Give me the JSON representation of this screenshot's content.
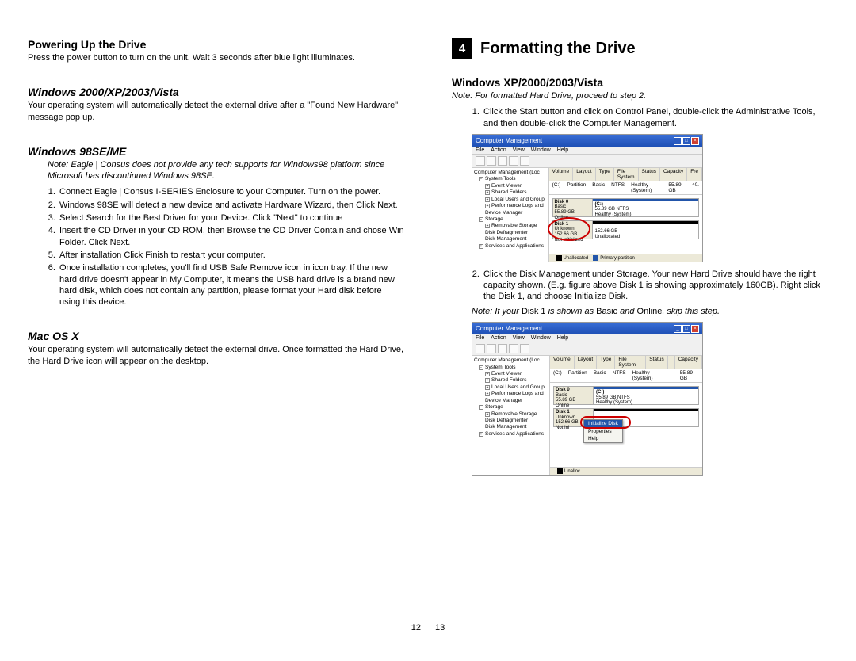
{
  "left": {
    "powering": {
      "heading": "Powering Up the Drive",
      "body": "Press the power button to turn on the unit. Wait 3 seconds after blue light illuminates."
    },
    "win2000": {
      "heading": "Windows 2000/XP/2003/Vista",
      "body": "Your operating system will automatically detect the external drive after a \"Found New Hardware\" message pop up."
    },
    "win98": {
      "heading": "Windows 98SE/ME",
      "note": "Note: Eagle | Consus does not provide any tech supports for Windows98 platform since Microsoft has discontinued Windows 98SE.",
      "steps": [
        "Connect Eagle | Consus I-SERIES Enclosure to your Computer. Turn on the power.",
        "Windows 98SE will detect a new device and activate Hardware Wizard, then Click Next.",
        "Select Search for the Best Driver for your Device. Click \"Next\" to continue",
        "Insert the CD Driver in your CD ROM, then Browse the CD Driver Contain and chose Win Folder. Click Next.",
        "After installation Click Finish to restart your computer.",
        "Once installation completes, you'll find USB Safe Remove icon in icon tray. If the new hard drive doesn't appear in My Computer, it means the USB hard drive is a brand new hard disk, which does not contain any partition, please format your Hard disk before using this device."
      ]
    },
    "macosx": {
      "heading": "Mac OS X",
      "body": "Your operating system will automatically detect the external drive. Once formatted the Hard Drive, the Hard Drive icon will appear on the desktop."
    }
  },
  "right": {
    "chapter": {
      "num": "4",
      "title": "Formatting the Drive"
    },
    "winxp": {
      "heading": "Windows XP/2000/2003/Vista",
      "note": "Note: For formatted Hard Drive, proceed to step 2.",
      "steps": [
        "Click the Start button and click on Control Panel, double-click the Administrative Tools, and then double-click the Computer Management.",
        "Click the Disk Management under Storage. Your new Hard Drive should have the right capacity shown. (E.g. figure above Disk 1 is showing approximately 160GB). Right click the Disk 1, and choose Initialize Disk."
      ],
      "note_mixed": {
        "p1": "Note: If your ",
        "b1": "Disk 1",
        "p2": " is shown as ",
        "b2": "Basic",
        "p3": " and ",
        "b3": "Online",
        "p4": ", skip this step."
      }
    }
  },
  "screenshot": {
    "title": "Computer Management",
    "menu": [
      "File",
      "Action",
      "View",
      "Window",
      "Help"
    ],
    "tree": {
      "root": "Computer Management (Loc",
      "systools": "System Tools",
      "items_sys": [
        "Event Viewer",
        "Shared Folders",
        "Local Users and Group",
        "Performance Logs and",
        "Device Manager"
      ],
      "storage": "Storage",
      "items_storage": [
        "Removable Storage",
        "Disk Defragmenter",
        "Disk Management"
      ],
      "services": "Services and Applications"
    },
    "cols": [
      "Volume",
      "Layout",
      "Type",
      "File System",
      "Status",
      "Capacity",
      "Fre"
    ],
    "row": {
      "vol": "(C:)",
      "layout": "Partition",
      "type": "Basic",
      "fs": "NTFS",
      "status": "Healthy (System)",
      "cap": "55.89 GB",
      "free": "40."
    },
    "disk0": {
      "name": "Disk 0",
      "type": "Basic",
      "size": "55.89 GB",
      "state": "Online",
      "part": "(C:)",
      "partdetail": "55.89 GB NTFS",
      "partstatus": "Healthy (System)"
    },
    "disk1_a": {
      "name": "Disk 1",
      "type": "Unknown",
      "size": "152.66 GB",
      "state": "Not Initialized",
      "part": "152.66 GB",
      "partdetail": "Unallocated"
    },
    "disk1_b": {
      "name": "Disk 1",
      "type": "Unknown",
      "size": "152.66 GB",
      "state": "Not Ini"
    },
    "ctx": {
      "init": "Initialize Disk",
      "props": "Properties",
      "help": "Help"
    },
    "legend": {
      "un": "Unallocated",
      "pp": "Primary partition"
    }
  },
  "pages": {
    "left": "12",
    "right": "13"
  }
}
